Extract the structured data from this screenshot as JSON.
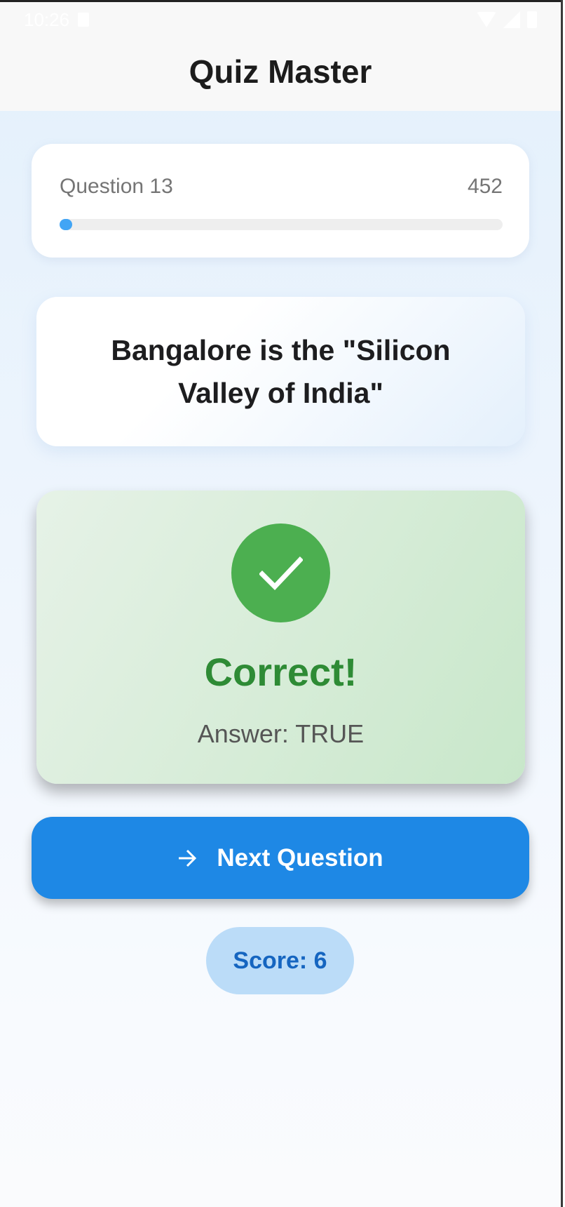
{
  "status_bar": {
    "time": "10:26",
    "icons": [
      "sim-card-icon",
      "wifi-icon",
      "signal-icon",
      "battery-icon"
    ]
  },
  "header": {
    "title": "Quiz Master"
  },
  "progress": {
    "question_label": "Question 13",
    "total": "452",
    "fraction": 0.0288,
    "bar_color": "#42a5f5"
  },
  "question": {
    "text": "Bangalore is the \"Silicon Valley of India\""
  },
  "result": {
    "icon": "check-icon",
    "title": "Correct!",
    "answer": "Answer: TRUE",
    "accent_color": "#4caf50"
  },
  "actions": {
    "next_label": "Next Question",
    "next_icon": "arrow-right-icon",
    "button_color": "#1e88e5"
  },
  "score": {
    "label": "Score: 6"
  }
}
